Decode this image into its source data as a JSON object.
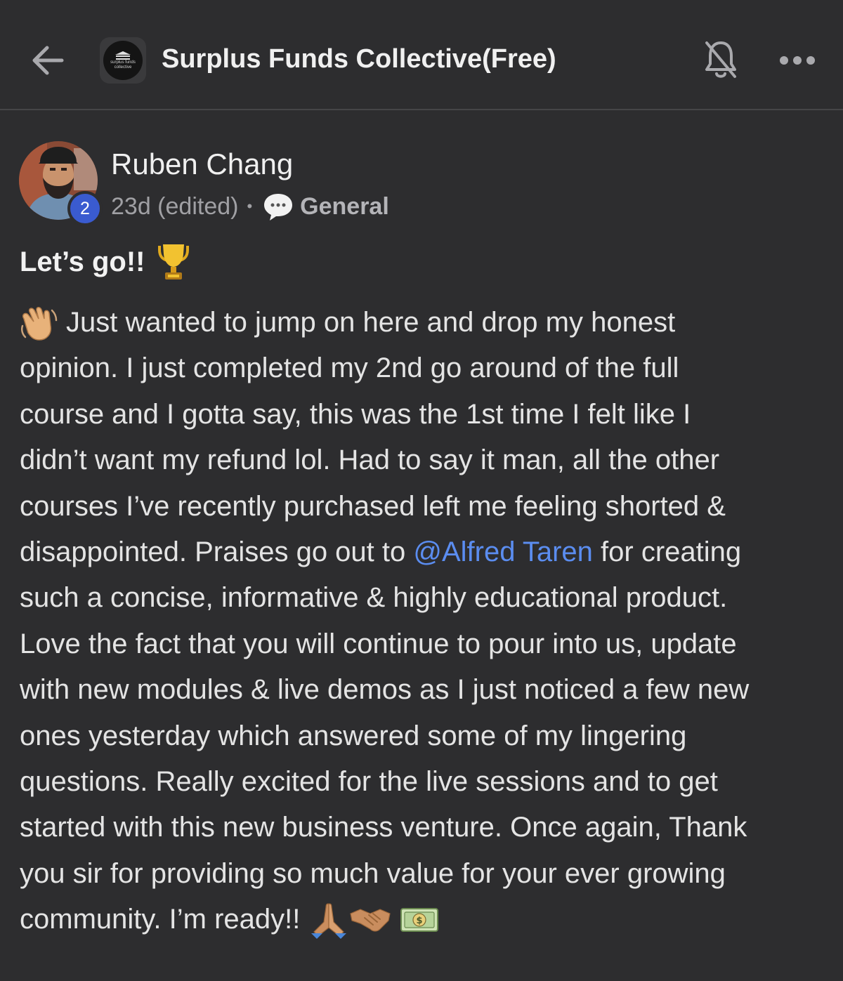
{
  "header": {
    "group_title": "Surplus Funds Collective(Free)",
    "logo_text_top": "surplus funds",
    "logo_text_bottom": "collective",
    "back_icon": "arrow-left-icon",
    "bell_icon": "bell-off-icon",
    "more_icon": "more-horizontal-icon"
  },
  "post": {
    "author": {
      "name": "Ruben Chang",
      "level": "2"
    },
    "time": "23d (edited)",
    "separator": "•",
    "category": "General",
    "category_icon": "speech-bubble-icon",
    "title": "Let’s go!!",
    "title_icon": "trophy-icon",
    "body_lines": {
      "l1": "Just wanted to jump on here and drop my honest",
      "l2": "opinion. I just completed my 2nd go around of the full",
      "l3": "course and I gotta say, this was the 1st time I felt like I",
      "l4": "didn’t want my refund lol. Had to say it man, all the other",
      "l5": "courses I’ve recently purchased left me feeling shorted &",
      "l6_before": "disappointed. Praises go out to ",
      "l6_mention": "@Alfred Taren",
      "l6_after": " for creating",
      "l7": "such a concise, informative & highly educational product.",
      "l8": "Love the fact that you will continue to pour into us, update",
      "l9": "with new modules & live demos as I just noticed a few new",
      "l10": "ones yesterday which answered some of my lingering",
      "l11": "questions. Really excited for the live sessions and to get",
      "l12": "started with this new business venture. Once again, Thank",
      "l13": "you sir for providing so much value for your ever growing",
      "l14": "community. I’m ready!!"
    },
    "emojis": [
      "waving-hand-icon",
      "folded-hands-icon",
      "handshake-icon",
      "money-bill-icon"
    ]
  },
  "colors": {
    "background": "#2d2d2f",
    "mention": "#5b8df0",
    "level_badge": "#3a5bd0"
  }
}
